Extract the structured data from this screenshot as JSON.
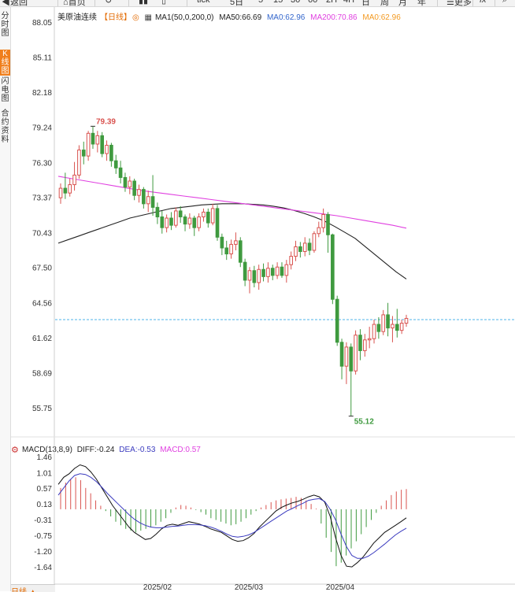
{
  "toolbar": {
    "back_label": "返回",
    "home_label": "首页",
    "periods": [
      "tick",
      "5日",
      "5",
      "15",
      "30",
      "60",
      "2H",
      "4H",
      "日",
      "周",
      "月",
      "年"
    ],
    "more_label": "更多",
    "fx_label": "fx"
  },
  "sidebar": {
    "items": [
      {
        "label": "分时图",
        "active": false
      },
      {
        "label": "K线图",
        "active": true
      },
      {
        "label": "闪电图",
        "active": false
      },
      {
        "label": "合约资料",
        "active": false
      }
    ]
  },
  "legend": {
    "name": "美原油连续",
    "period": "【日线】",
    "ma1": "MA1(50,0,200,0)",
    "ma50": "MA50:66.69",
    "ma0a": "MA0:62.96",
    "ma200": "MA200:70.86",
    "ma0b": "MA0:62.96"
  },
  "macd_legend": {
    "name": "MACD(13,8,9)",
    "diff": "DIFF:-0.24",
    "dea": "DEA:-0.53",
    "macd": "MACD:0.57"
  },
  "bottom_tab": "日线",
  "colors": {
    "up": "#d9534f",
    "down": "#3f9a3f",
    "ma50": "#222222",
    "ma200": "#e040e0",
    "price_line": "#4fb3e8",
    "accent": "#f07f1c"
  },
  "chart_data": [
    {
      "type": "candlestick",
      "y_ticks": [
        "88.05",
        "85.11",
        "82.18",
        "79.24",
        "76.30",
        "73.37",
        "70.43",
        "67.50",
        "64.56",
        "61.62",
        "58.69",
        "55.75"
      ],
      "ylim": [
        54.5,
        88.05
      ],
      "x_ticks": [
        "2025/02",
        "2025/03",
        "2025/04"
      ],
      "annotations": {
        "high": "79.39",
        "low": "55.12"
      },
      "current_price": 63.2,
      "candles": [
        [
          73.4,
          74.2,
          72.9,
          74.6
        ],
        [
          74.2,
          73.8,
          73.3,
          75.5
        ],
        [
          73.8,
          74.5,
          73.5,
          75.0
        ],
        [
          74.5,
          75.3,
          74.0,
          76.4
        ],
        [
          75.3,
          77.4,
          75.0,
          77.8
        ],
        [
          77.4,
          76.9,
          76.2,
          78.1
        ],
        [
          76.9,
          78.8,
          76.5,
          79.0
        ],
        [
          78.8,
          77.9,
          77.5,
          79.4
        ],
        [
          77.9,
          78.6,
          77.2,
          79.0
        ],
        [
          78.6,
          77.1,
          76.8,
          78.9
        ],
        [
          77.1,
          77.8,
          76.5,
          78.2
        ],
        [
          77.8,
          76.5,
          76.0,
          78.0
        ],
        [
          76.5,
          75.9,
          75.4,
          77.0
        ],
        [
          75.9,
          75.1,
          74.6,
          76.5
        ],
        [
          75.1,
          74.3,
          73.9,
          75.5
        ],
        [
          74.3,
          74.8,
          73.7,
          75.2
        ],
        [
          74.8,
          73.6,
          73.2,
          75.0
        ],
        [
          73.6,
          74.1,
          73.0,
          74.5
        ],
        [
          74.1,
          72.9,
          72.5,
          74.3
        ],
        [
          72.9,
          73.5,
          72.2,
          74.0
        ],
        [
          73.5,
          72.6,
          71.9,
          75.3
        ],
        [
          72.6,
          71.8,
          71.2,
          73.0
        ],
        [
          71.8,
          70.9,
          70.4,
          72.3
        ],
        [
          70.9,
          71.7,
          70.5,
          72.0
        ],
        [
          71.7,
          71.1,
          70.7,
          72.2
        ],
        [
          71.1,
          72.3,
          70.9,
          72.6
        ],
        [
          72.3,
          71.8,
          71.3,
          72.7
        ],
        [
          71.8,
          71.2,
          70.6,
          72.0
        ],
        [
          71.2,
          71.7,
          70.8,
          72.1
        ],
        [
          71.7,
          70.9,
          70.2,
          71.9
        ],
        [
          70.9,
          71.8,
          70.6,
          72.1
        ],
        [
          71.8,
          72.2,
          71.4,
          72.5
        ],
        [
          72.2,
          71.3,
          70.9,
          72.5
        ],
        [
          71.3,
          72.5,
          71.1,
          72.9
        ],
        [
          72.5,
          70.1,
          69.8,
          72.8
        ],
        [
          70.1,
          69.2,
          68.6,
          70.4
        ],
        [
          69.2,
          68.7,
          68.2,
          69.8
        ],
        [
          68.7,
          69.5,
          68.3,
          69.9
        ],
        [
          69.5,
          69.8,
          69.0,
          70.5
        ],
        [
          69.8,
          68.0,
          67.6,
          70.1
        ],
        [
          68.0,
          66.5,
          66.0,
          68.3
        ],
        [
          66.5,
          67.3,
          65.4,
          67.6
        ],
        [
          67.3,
          66.3,
          65.9,
          67.7
        ],
        [
          66.3,
          67.4,
          65.7,
          67.8
        ],
        [
          67.4,
          66.8,
          66.4,
          67.9
        ],
        [
          66.8,
          67.5,
          66.3,
          68.0
        ],
        [
          67.5,
          66.9,
          66.5,
          67.8
        ],
        [
          66.9,
          67.6,
          66.6,
          68.0
        ],
        [
          67.6,
          66.9,
          66.7,
          68.0
        ],
        [
          66.9,
          67.8,
          66.3,
          68.2
        ],
        [
          67.8,
          68.5,
          67.4,
          68.9
        ],
        [
          68.5,
          69.3,
          68.1,
          69.8
        ],
        [
          69.3,
          68.9,
          68.4,
          69.7
        ],
        [
          68.9,
          69.6,
          68.5,
          70.1
        ],
        [
          69.6,
          69.0,
          68.6,
          70.0
        ],
        [
          69.0,
          70.4,
          68.8,
          70.6
        ],
        [
          70.4,
          70.9,
          70.1,
          71.4
        ],
        [
          70.9,
          72.0,
          70.5,
          72.5
        ],
        [
          72.0,
          70.3,
          68.8,
          72.2
        ],
        [
          70.3,
          64.9,
          64.5,
          70.4
        ],
        [
          64.9,
          61.3,
          61.0,
          65.2
        ],
        [
          61.3,
          59.3,
          58.2,
          61.6
        ],
        [
          59.3,
          60.9,
          57.8,
          61.3
        ],
        [
          60.9,
          58.9,
          55.1,
          61.2
        ],
        [
          58.9,
          61.9,
          58.6,
          62.3
        ],
        [
          61.9,
          60.6,
          59.8,
          62.4
        ],
        [
          60.6,
          61.5,
          60.1,
          62.0
        ],
        [
          61.5,
          61.6,
          60.8,
          62.6
        ],
        [
          61.6,
          62.8,
          61.2,
          63.2
        ],
        [
          62.8,
          62.2,
          61.6,
          63.4
        ],
        [
          62.2,
          63.6,
          61.9,
          64.0
        ],
        [
          63.6,
          62.5,
          61.8,
          64.6
        ],
        [
          62.5,
          62.8,
          61.3,
          63.5
        ],
        [
          62.8,
          62.3,
          61.7,
          64.1
        ],
        [
          62.3,
          62.9,
          62.0,
          63.2
        ],
        [
          62.9,
          63.3,
          62.6,
          63.6
        ]
      ],
      "ma50": [
        69.6,
        69.9,
        70.2,
        70.5,
        70.8,
        71.1,
        71.4,
        71.7,
        71.9,
        72.1,
        72.3,
        72.5,
        72.6,
        72.7,
        72.8,
        72.85,
        72.9,
        72.9,
        72.9,
        72.85,
        72.8,
        72.7,
        72.55,
        72.35,
        72.1,
        71.8,
        71.45,
        71.0,
        70.5,
        70.0,
        69.3,
        68.6,
        67.9,
        67.2,
        66.6
      ],
      "ma200": [
        75.2,
        75.0,
        74.8,
        74.6,
        74.4,
        74.2,
        74.0,
        73.85,
        73.7,
        73.55,
        73.4,
        73.25,
        73.1,
        72.95,
        72.8,
        72.65,
        72.5,
        72.35,
        72.2,
        72.05,
        71.9,
        71.7,
        71.5,
        71.3,
        71.1,
        70.86
      ]
    },
    {
      "type": "bar+line",
      "y_ticks": [
        "1.46",
        "1.01",
        "0.57",
        "0.13",
        "-0.31",
        "-0.75",
        "-1.20",
        "-1.64"
      ],
      "ylim": [
        -1.9,
        1.55
      ],
      "series": [
        {
          "name": "MACD",
          "values": [
            0.6,
            0.75,
            0.85,
            0.9,
            0.82,
            0.6,
            0.45,
            0.25,
            0.1,
            -0.05,
            -0.2,
            -0.35,
            -0.45,
            -0.55,
            -0.6,
            -0.65,
            -0.6,
            -0.55,
            -0.5,
            -0.45,
            -0.35,
            -0.25,
            -0.1,
            0.05,
            0.12,
            0.1,
            0.05,
            -0.02,
            -0.08,
            -0.15,
            -0.25,
            -0.3,
            -0.35,
            -0.4,
            -0.45,
            -0.42,
            -0.35,
            -0.25,
            -0.15,
            -0.05,
            0.05,
            0.12,
            0.2,
            0.25,
            0.28,
            0.3,
            0.32,
            0.35,
            0.32,
            0.25,
            0.15,
            0.02,
            -0.4,
            -0.8,
            -1.2,
            -1.6,
            -1.5,
            -1.3,
            -1.1,
            -0.9,
            -0.7,
            -0.5,
            -0.3,
            -0.1,
            0.1,
            0.25,
            0.4,
            0.5,
            0.55,
            0.57
          ]
        },
        {
          "name": "DIFF",
          "values": [
            0.7,
            0.9,
            1.0,
            1.15,
            1.25,
            1.2,
            1.05,
            0.85,
            0.6,
            0.35,
            0.1,
            -0.1,
            -0.3,
            -0.5,
            -0.65,
            -0.75,
            -0.85,
            -0.82,
            -0.7,
            -0.55,
            -0.45,
            -0.42,
            -0.45,
            -0.4,
            -0.35,
            -0.38,
            -0.42,
            -0.48,
            -0.55,
            -0.6,
            -0.65,
            -0.75,
            -0.85,
            -0.9,
            -0.88,
            -0.8,
            -0.68,
            -0.5,
            -0.35,
            -0.2,
            -0.05,
            0.05,
            0.12,
            0.18,
            0.22,
            0.28,
            0.35,
            0.4,
            0.35,
            0.2,
            -0.2,
            -0.8,
            -1.3,
            -1.6,
            -1.62,
            -1.5,
            -1.35,
            -1.15,
            -0.95,
            -0.8,
            -0.65,
            -0.55,
            -0.45,
            -0.35,
            -0.24
          ]
        },
        {
          "name": "DEA",
          "values": [
            0.4,
            0.6,
            0.8,
            0.95,
            1.0,
            0.98,
            0.9,
            0.78,
            0.62,
            0.45,
            0.3,
            0.15,
            0.0,
            -0.15,
            -0.28,
            -0.38,
            -0.45,
            -0.5,
            -0.52,
            -0.52,
            -0.5,
            -0.48,
            -0.47,
            -0.45,
            -0.43,
            -0.43,
            -0.44,
            -0.46,
            -0.5,
            -0.55,
            -0.62,
            -0.7,
            -0.76,
            -0.78,
            -0.76,
            -0.72,
            -0.65,
            -0.55,
            -0.45,
            -0.35,
            -0.25,
            -0.15,
            -0.05,
            0.02,
            0.1,
            0.17,
            0.25,
            0.28,
            0.3,
            0.22,
            0.0,
            -0.3,
            -0.7,
            -1.05,
            -1.3,
            -1.38,
            -1.38,
            -1.32,
            -1.22,
            -1.1,
            -0.98,
            -0.85,
            -0.72,
            -0.62,
            -0.53
          ]
        }
      ]
    }
  ]
}
